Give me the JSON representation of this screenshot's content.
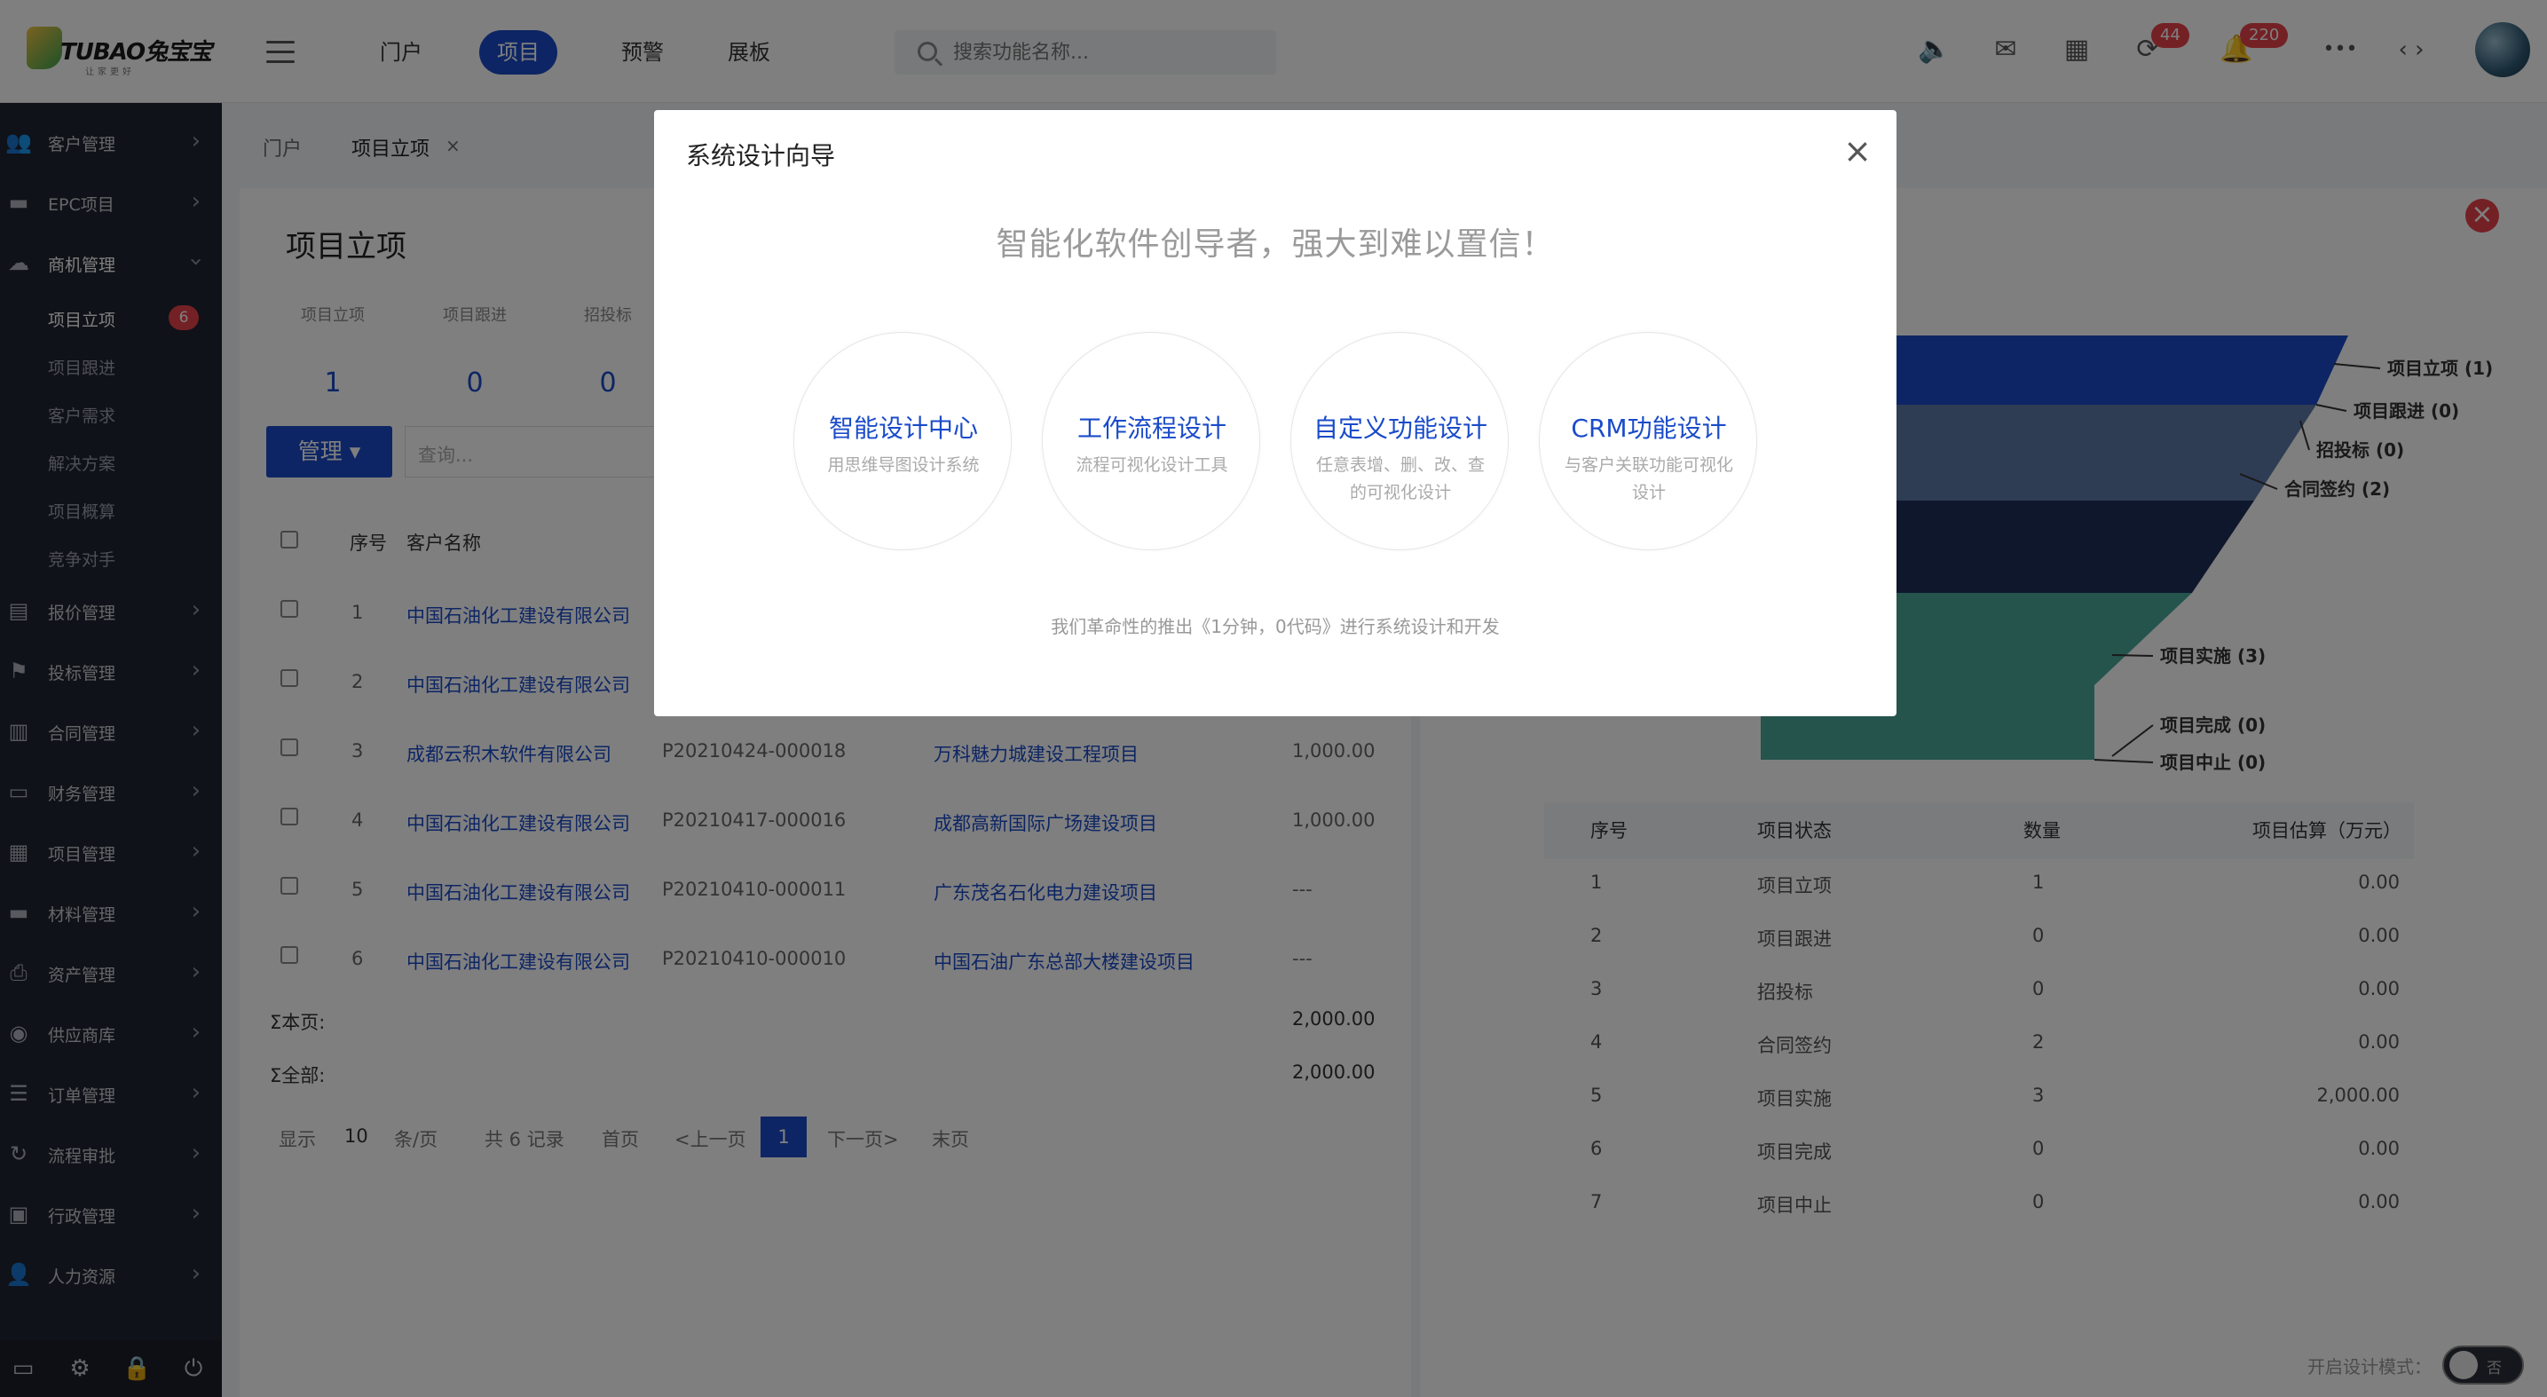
{
  "brand": {
    "logo_text": "TUBAO兔宝宝",
    "logo_sub": "让家更好"
  },
  "topnav": {
    "items": [
      "门户",
      "项目",
      "预警",
      "展板"
    ],
    "active_index": 1
  },
  "search": {
    "placeholder": "搜索功能名称..."
  },
  "top_icons": [
    {
      "name": "speaker-icon",
      "glyph": "🔈"
    },
    {
      "name": "mail-icon",
      "glyph": "✉"
    },
    {
      "name": "calendar-icon",
      "glyph": "▦"
    },
    {
      "name": "sync-icon",
      "glyph": "⟳",
      "badge": "44"
    },
    {
      "name": "bell-icon",
      "glyph": "🔔",
      "badge": "220"
    },
    {
      "name": "more-icon",
      "glyph": "•••"
    },
    {
      "name": "code-icon",
      "glyph": "‹ ›"
    }
  ],
  "sidebar": {
    "items": [
      {
        "label": "客户管理",
        "icon": "users-icon"
      },
      {
        "label": "EPC项目",
        "icon": "folder-icon"
      },
      {
        "label": "商机管理",
        "icon": "cloud-icon",
        "expanded": true
      },
      {
        "label": "报价管理",
        "icon": "clipboard-icon"
      },
      {
        "label": "投标管理",
        "icon": "flag-icon"
      },
      {
        "label": "合同管理",
        "icon": "book-icon"
      },
      {
        "label": "财务管理",
        "icon": "card-icon"
      },
      {
        "label": "项目管理",
        "icon": "table-icon"
      },
      {
        "label": "材料管理",
        "icon": "folder-icon"
      },
      {
        "label": "资产管理",
        "icon": "printer-icon"
      },
      {
        "label": "供应商库",
        "icon": "circle-icon"
      },
      {
        "label": "订单管理",
        "icon": "list-icon"
      },
      {
        "label": "流程审批",
        "icon": "refresh-icon"
      },
      {
        "label": "行政管理",
        "icon": "briefcase-icon"
      },
      {
        "label": "人力资源",
        "icon": "user-icon"
      }
    ],
    "subitems": [
      "项目立项",
      "项目跟进",
      "客户需求",
      "解决方案",
      "项目概算",
      "竞争对手"
    ],
    "sub_badge": "6"
  },
  "tabs": {
    "home": "门户",
    "current": "项目立项",
    "close": "×"
  },
  "page": {
    "title": "项目立项",
    "stats": [
      {
        "label": "项目立项",
        "value": "1"
      },
      {
        "label": "项目跟进",
        "value": "0"
      },
      {
        "label": "招投标",
        "value": "0"
      }
    ],
    "manage_button": "管理 ▾",
    "query_placeholder": "查询...",
    "table": {
      "headers": [
        "序号",
        "客户名称"
      ],
      "rows": [
        {
          "no": "1",
          "customer": "中国石油化工建设有限公司",
          "code": "",
          "project": "",
          "amount": ""
        },
        {
          "no": "2",
          "customer": "中国石油化工建设有限公司",
          "code": "",
          "project": "",
          "amount": ""
        },
        {
          "no": "3",
          "customer": "成都云积木软件有限公司",
          "code": "P20210424-000018",
          "project": "万科魅力城建设工程项目",
          "amount": "1,000.00"
        },
        {
          "no": "4",
          "customer": "中国石油化工建设有限公司",
          "code": "P20210417-000016",
          "project": "成都高新国际广场建设项目",
          "amount": "1,000.00"
        },
        {
          "no": "5",
          "customer": "中国石油化工建设有限公司",
          "code": "P20210410-000011",
          "project": "广东茂名石化电力建设项目",
          "amount": "---"
        },
        {
          "no": "6",
          "customer": "中国石油化工建设有限公司",
          "code": "P20210410-000010",
          "project": "中国石油广东总部大楼建设项目",
          "amount": "---"
        }
      ],
      "sum_page_label": "Σ本页:",
      "sum_page": "2,000.00",
      "sum_all_label": "Σ全部:",
      "sum_all": "2,000.00"
    },
    "pager": {
      "show": "显示",
      "size": "10",
      "per": "条/页",
      "total": "共 6 记录",
      "first": "首页",
      "prev": "<上一页",
      "current": "1",
      "next": "下一页>",
      "last": "末页"
    }
  },
  "funnel": {
    "labels": [
      "项目立项 (1)",
      "项目跟进 (0)",
      "招投标 (0)",
      "合同签约 (2)",
      "项目实施 (3)",
      "项目完成 (0)",
      "项目中止 (0)"
    ],
    "colors": [
      "#1a4bc9",
      "#3f5e9e",
      "#5d7aa8",
      "#1e2e5a",
      "#4aa89a",
      "#4aa89a",
      "#4aa89a"
    ]
  },
  "status_table": {
    "headers": [
      "序号",
      "项目状态",
      "数量",
      "项目估算（万元）"
    ],
    "rows": [
      [
        "1",
        "项目立项",
        "1",
        "0.00"
      ],
      [
        "2",
        "项目跟进",
        "0",
        "0.00"
      ],
      [
        "3",
        "招投标",
        "0",
        "0.00"
      ],
      [
        "4",
        "合同签约",
        "2",
        "0.00"
      ],
      [
        "5",
        "项目实施",
        "3",
        "2,000.00"
      ],
      [
        "6",
        "项目完成",
        "0",
        "0.00"
      ],
      [
        "7",
        "项目中止",
        "0",
        "0.00"
      ]
    ]
  },
  "modal": {
    "title": "系统设计向导",
    "close": "×",
    "slogan": "智能化软件创导者，强大到难以置信！",
    "cards": [
      {
        "title": "智能设计中心",
        "desc": "用思维导图设计系统"
      },
      {
        "title": "工作流程设计",
        "desc": "流程可视化设计工具"
      },
      {
        "title": "自定义功能设计",
        "desc": "任意表增、删、改、查的可视化设计"
      },
      {
        "title": "CRM功能设计",
        "desc": "与客户关联功能可视化设计"
      }
    ],
    "footer": "我们革命性的推出《1分钟，0代码》进行系统设计和开发"
  },
  "design_mode": {
    "label": "开启设计模式：",
    "toggle_text": "否"
  }
}
